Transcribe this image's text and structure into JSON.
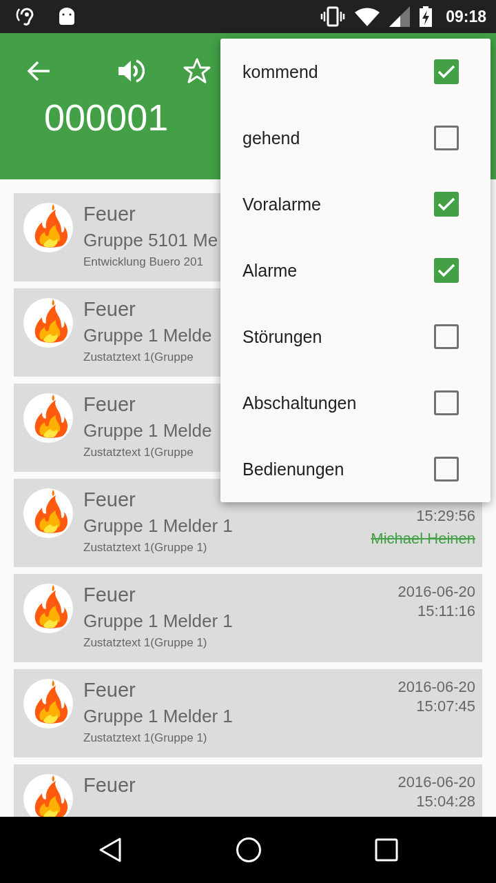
{
  "status_bar": {
    "time": "09:18"
  },
  "toolbar": {
    "title": "000001"
  },
  "filter_menu": {
    "items": [
      {
        "label": "kommend",
        "checked": true
      },
      {
        "label": "gehend",
        "checked": false
      },
      {
        "label": "Voralarme",
        "checked": true
      },
      {
        "label": "Alarme",
        "checked": true
      },
      {
        "label": "Störungen",
        "checked": false
      },
      {
        "label": "Abschaltungen",
        "checked": false
      },
      {
        "label": "Bedienungen",
        "checked": false
      }
    ]
  },
  "alarms": [
    {
      "title": "Feuer",
      "line_2": "Gruppe 5101 Me",
      "line_3": "Entwicklung Buero 201"
    },
    {
      "title": "Feuer",
      "line_2": "Gruppe 1 Melde",
      "line_3": "Zustatztext 1(Gruppe"
    },
    {
      "title": "Feuer",
      "line_2": "Gruppe 1 Melde",
      "line_3": "Zustatztext 1(Gruppe"
    },
    {
      "title": "Feuer",
      "line_2": "Gruppe 1 Melder 1",
      "line_3": "Zustatztext 1(Gruppe 1)",
      "time": "15:29:56",
      "operator": "Michael Heinen",
      "struck": true
    },
    {
      "title": "Feuer",
      "line_2": "Gruppe 1 Melder 1",
      "line_3": "Zustatztext 1(Gruppe 1)",
      "date": "2016-06-20",
      "time": "15:11:16"
    },
    {
      "title": "Feuer",
      "line_2": "Gruppe 1 Melder 1",
      "line_3": "Zustatztext 1(Gruppe 1)",
      "date": "2016-06-20",
      "time": "15:07:45"
    },
    {
      "title": "Feuer",
      "date": "2016-06-20",
      "time": "15:04:28"
    }
  ]
}
